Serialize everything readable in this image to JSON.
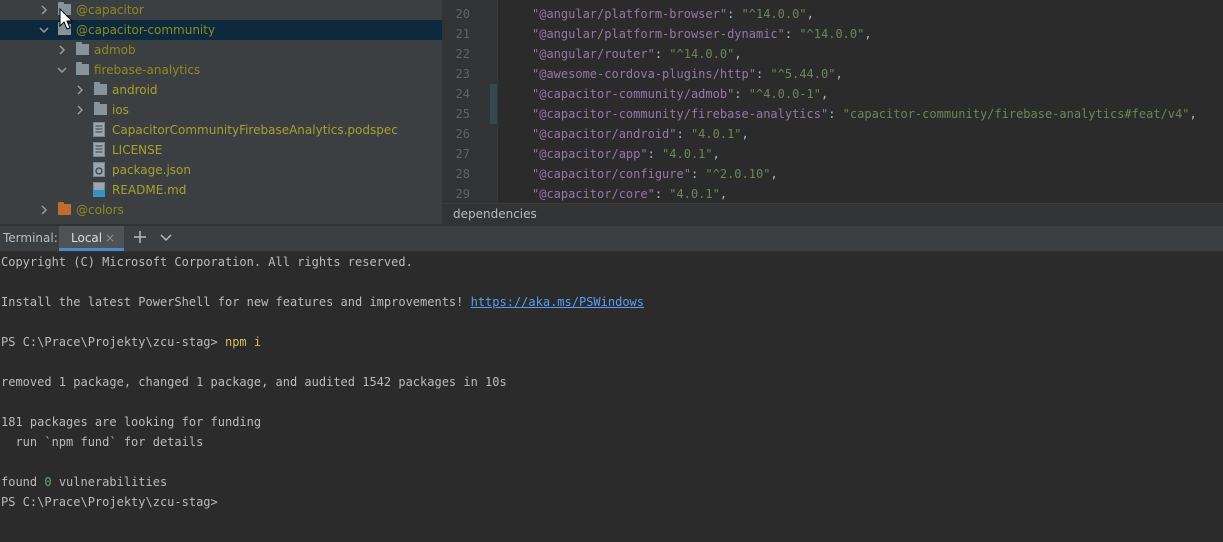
{
  "project_tree": {
    "items": [
      {
        "label": "@capacitor",
        "expanded": false,
        "type": "folder"
      },
      {
        "label": "@capacitor-community",
        "expanded": true,
        "type": "folder",
        "selected": true
      },
      {
        "label": "admob",
        "expanded": false,
        "type": "folder"
      },
      {
        "label": "firebase-analytics",
        "expanded": true,
        "type": "folder"
      },
      {
        "label": "android",
        "expanded": false,
        "type": "folder"
      },
      {
        "label": "ios",
        "expanded": false,
        "type": "folder"
      },
      {
        "label": "CapacitorCommunityFirebaseAnalytics.podspec",
        "type": "file"
      },
      {
        "label": "LICENSE",
        "type": "file"
      },
      {
        "label": "package.json",
        "type": "file"
      },
      {
        "label": "README.md",
        "type": "file"
      },
      {
        "label": "@colors",
        "expanded": false,
        "type": "folder"
      }
    ]
  },
  "editor": {
    "lines": [
      {
        "num": "20",
        "key": "\"@angular/platform-browser\"",
        "value": "\"^14.0.0\""
      },
      {
        "num": "21",
        "key": "\"@angular/platform-browser-dynamic\"",
        "value": "\"^14.0.0\""
      },
      {
        "num": "22",
        "key": "\"@angular/router\"",
        "value": "\"^14.0.0\""
      },
      {
        "num": "23",
        "key": "\"@awesome-cordova-plugins/http\"",
        "value": "\"^5.44.0\""
      },
      {
        "num": "24",
        "key": "\"@capacitor-community/admob\"",
        "value": "\"^4.0.0-1\""
      },
      {
        "num": "25",
        "key": "\"@capacitor-community/firebase-analytics\"",
        "value": "\"capacitor-community/firebase-analytics#feat/v4\""
      },
      {
        "num": "26",
        "key": "\"@capacitor/android\"",
        "value": "\"4.0.1\""
      },
      {
        "num": "27",
        "key": "\"@capacitor/app\"",
        "value": "\"4.0.1\""
      },
      {
        "num": "28",
        "key": "\"@capacitor/configure\"",
        "value": "\"^2.0.10\""
      },
      {
        "num": "29",
        "key": "\"@capacitor/core\"",
        "value": "\"4.0.1\""
      }
    ],
    "breadcrumb": "dependencies"
  },
  "terminal": {
    "title": "Terminal:",
    "tab_label": "Local",
    "tab_close": "×",
    "lines": {
      "copyright": "Copyright (C) Microsoft Corporation. All rights reserved.",
      "install_text": "Install the latest PowerShell for new features and improvements! ",
      "install_link": "https://aka.ms/PSWindows",
      "prompt1": "PS C:\\Prace\\Projekty\\zcu-stag> ",
      "command": "npm i",
      "removed": "removed 1 package, changed 1 package, and audited 1542 packages in 10s",
      "funding": "181 packages are looking for funding",
      "fund_details": "  run `npm fund` for details",
      "found_prefix": "found ",
      "found_num": "0",
      "found_suffix": " vulnerabilities",
      "prompt2": "PS C:\\Prace\\Projekty\\zcu-stag>"
    }
  },
  "colors": {
    "tree_bg": "#3c3f41",
    "selection": "#0d293e",
    "folder": "#87939a",
    "folder_orange": "#c36b2b",
    "json_key": "#9876aa",
    "json_string": "#6a8759",
    "command": "#d6bf55",
    "link": "#589df6"
  }
}
